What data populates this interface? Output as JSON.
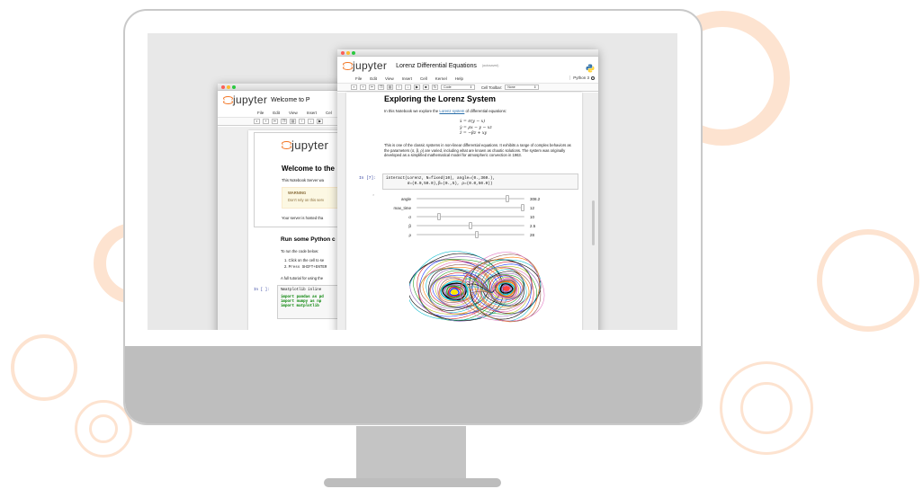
{
  "colors": {
    "accent_orange": "#f37726",
    "ring_light": "#fde3d0",
    "monitor_chin": "#bebebe"
  },
  "back_window": {
    "app_name": "jupyter",
    "notebook_title": "Welcome to P",
    "menu": [
      "File",
      "Edit",
      "View",
      "Insert",
      "Cel"
    ],
    "logo_text": "jupyter",
    "heading": "Welcome to the",
    "intro": "This Notebook Server wa",
    "warning_title": "WARNING",
    "warning_text": "Don't rely on this serv",
    "hosted_text": "Your server is hosted tha",
    "section_heading": "Run some Python c",
    "run_intro": "To run the code below:",
    "steps": [
      "Click on the cell to se",
      "Press SHIFT+ENTER"
    ],
    "tutorial_text": "A full tutorial for using the",
    "cell_prompt": "In [ ]:",
    "code_lines": [
      "%matplotlib inline",
      "import pandas as pd",
      "import numpy as np",
      "import matplotlib"
    ]
  },
  "front_window": {
    "app_name": "jupyter",
    "notebook_title": "Lorenz Differential Equations",
    "save_status": "(autosaved)",
    "menu": [
      "File",
      "Edit",
      "View",
      "Insert",
      "Cell",
      "Kernel",
      "Help"
    ],
    "kernel_name": "Python 3",
    "toolbar": {
      "buttons": [
        "save-icon",
        "plus-icon",
        "cut-icon",
        "copy-icon",
        "paste-icon",
        "arrow-up-icon",
        "arrow-down-icon",
        "run-icon",
        "stop-icon",
        "restart-icon"
      ],
      "cell_type": "Code",
      "cell_toolbar_label": "Cell Toolbar:",
      "cell_toolbar_value": "None"
    },
    "heading": "Exploring the Lorenz System",
    "intro_before_link": "In this Notebook we explore the ",
    "intro_link": "Lorenz system",
    "intro_after_link": " of differential equations:",
    "equations": [
      "ẋ = σ(y − x)",
      "ẏ = ρx − y − xz",
      "ż = −βz + xy"
    ],
    "description": "This is one of the classic systems in non-linear differential equations. It exhibits a range of complex behaviors as the parameters (σ, β, ρ) are varied, including what are known as chaotic solutions. The system was originally developed as a simplified mathematical model for atmospheric convection in 1963.",
    "cell_prompt": "In [7]:",
    "code_lines": [
      "interact(Lorenz, N=fixed(10), angle=(0.,360.),",
      "         σ=(0.0,50.0),β=(0.,5), ρ=(0.0,50.0))"
    ],
    "sliders": [
      {
        "label": "angle",
        "value": "308.2",
        "fraction": 0.856
      },
      {
        "label": "max_time",
        "value": "12",
        "fraction": 1.0
      },
      {
        "label": "σ",
        "value": "10",
        "fraction": 0.2
      },
      {
        "label": "β",
        "value": "2.5",
        "fraction": 0.5
      },
      {
        "label": "ρ",
        "value": "28",
        "fraction": 0.56
      }
    ],
    "attractor_colors": [
      "#1f3cff",
      "#d62728",
      "#2ca02c",
      "#9467bd",
      "#000000",
      "#17becf",
      "#ff7f0e",
      "#8c564b",
      "#e377c2",
      "#bcbd22"
    ]
  }
}
